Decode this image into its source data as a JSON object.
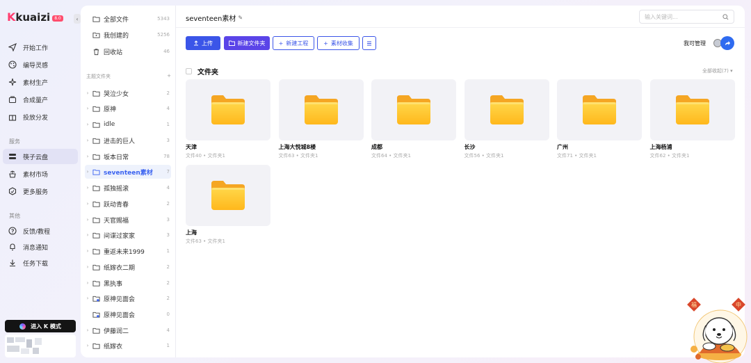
{
  "app": {
    "logo_mark": "K",
    "logo_text": "kuaizi",
    "version": "8.0"
  },
  "nav": {
    "items": [
      {
        "label": "开始工作",
        "icon": "send-icon"
      },
      {
        "label": "编导灵感",
        "icon": "palette-icon"
      },
      {
        "label": "素材生产",
        "icon": "sparkle-icon"
      },
      {
        "label": "合成量产",
        "icon": "layers-icon"
      },
      {
        "label": "投放分发",
        "icon": "gift-icon"
      }
    ],
    "service_label": "服务",
    "service_items": [
      {
        "label": "筷子云盘",
        "icon": "cloud-drive-icon",
        "active": true
      },
      {
        "label": "素材市场",
        "icon": "market-icon"
      },
      {
        "label": "更多服务",
        "icon": "hexagon-icon"
      }
    ],
    "other_label": "其他",
    "other_items": [
      {
        "label": "反馈/教程",
        "icon": "feedback-icon"
      },
      {
        "label": "消息通知",
        "icon": "bell-icon"
      },
      {
        "label": "任务下载",
        "icon": "download-icon"
      }
    ],
    "enter_button": "进入 K 模式"
  },
  "tree": {
    "top_items": [
      {
        "label": "全部文件",
        "count": "5343"
      },
      {
        "label": "我创建的",
        "count": "5256"
      },
      {
        "label": "回收站",
        "count": "46"
      }
    ],
    "section_label": "主题文件夹",
    "add_label": "+",
    "folders": [
      {
        "label": "哭泣少女",
        "count": "2"
      },
      {
        "label": "原神",
        "count": "4"
      },
      {
        "label": "idle",
        "count": "1"
      },
      {
        "label": "进击的巨人",
        "count": "3"
      },
      {
        "label": "坂本日常",
        "count": "78"
      },
      {
        "label": "seventeen素材",
        "count": "7",
        "selected": true
      },
      {
        "label": "孤独摇滚",
        "count": "4"
      },
      {
        "label": "跃动青春",
        "count": "2"
      },
      {
        "label": "天官赐福",
        "count": "3"
      },
      {
        "label": "间谍过家家",
        "count": "3"
      },
      {
        "label": "重返未来1999",
        "count": "1"
      },
      {
        "label": "纸嫁衣二期",
        "count": "2"
      },
      {
        "label": "黑执事",
        "count": "2"
      },
      {
        "label": "原神见面会",
        "count": "2",
        "shared": true
      },
      {
        "label": "原神见面会",
        "count": "0",
        "shared": true,
        "no_caret": true
      },
      {
        "label": "伊藤润二",
        "count": "4"
      },
      {
        "label": "纸嫁衣",
        "count": "1"
      }
    ]
  },
  "main": {
    "title": "seventeen素材",
    "search_placeholder": "输入关键词...",
    "buttons": {
      "upload": "上传",
      "new_folder": "新建文件夹",
      "new_project": "新建工程",
      "collect": "素材收集"
    },
    "manage_label": "我可管理",
    "section_title": "文件夹",
    "expand_label": "全部收起(7) ▾",
    "folders": [
      {
        "name": "天津",
        "meta": "文件40 • 文件夹1"
      },
      {
        "name": "上海大悦城8楼",
        "meta": "文件63 • 文件夹1"
      },
      {
        "name": "成都",
        "meta": "文件64 • 文件夹1"
      },
      {
        "name": "长沙",
        "meta": "文件56 • 文件夹1"
      },
      {
        "name": "广州",
        "meta": "文件71 • 文件夹1"
      },
      {
        "name": "上海杨浦",
        "meta": "文件62 • 文件夹1"
      },
      {
        "name": "上海",
        "meta": "文件63 • 文件夹1"
      }
    ]
  },
  "colors": {
    "primary": "#3b55e8",
    "accent": "#5a44e8",
    "folder": "#ffc21a"
  },
  "mascot": {
    "badge_left": "福",
    "badge_right": "中"
  }
}
